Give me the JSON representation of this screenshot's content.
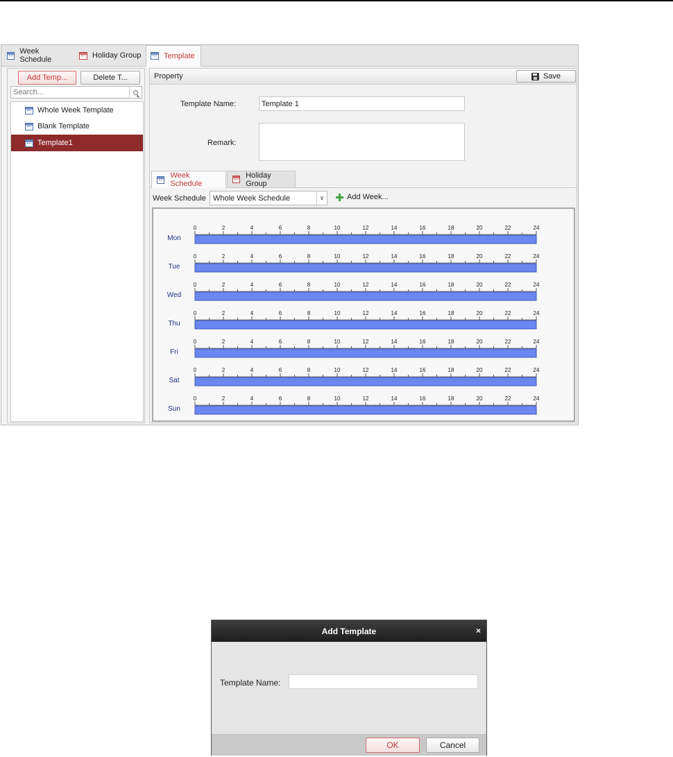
{
  "top_tabs": [
    {
      "label": "Week Schedule",
      "icon": "calendar-icon"
    },
    {
      "label": "Holiday Group",
      "icon": "holiday-calendar-icon"
    },
    {
      "label": "Template",
      "icon": "template-icon",
      "active": true
    }
  ],
  "left_panel": {
    "add_button": "Add Temp...",
    "delete_button": "Delete T...",
    "search_placeholder": "Search...",
    "templates": [
      {
        "label": "Whole Week Template",
        "selected": false
      },
      {
        "label": "Blank Template",
        "selected": false
      },
      {
        "label": "Template1",
        "selected": true
      }
    ]
  },
  "property": {
    "title": "Property",
    "save_label": "Save",
    "template_name_label": "Template Name:",
    "template_name_value": "Template 1",
    "remark_label": "Remark:",
    "remark_value": ""
  },
  "sub_tabs": [
    {
      "label": "Week Schedule",
      "active": true
    },
    {
      "label": "Holiday Group",
      "active": false
    }
  ],
  "week_schedule": {
    "label": "Week Schedule",
    "selected": "Whole Week Schedule",
    "add_week_label": "Add Week...",
    "hour_labels": [
      "0",
      "2",
      "4",
      "6",
      "8",
      "10",
      "12",
      "14",
      "16",
      "18",
      "20",
      "22",
      "24"
    ],
    "days": [
      {
        "day": "Mon",
        "start": 0,
        "end": 24
      },
      {
        "day": "Tue",
        "start": 0,
        "end": 24
      },
      {
        "day": "Wed",
        "start": 0,
        "end": 24
      },
      {
        "day": "Thu",
        "start": 0,
        "end": 24
      },
      {
        "day": "Fri",
        "start": 0,
        "end": 24
      },
      {
        "day": "Sat",
        "start": 0,
        "end": 24
      },
      {
        "day": "Sun",
        "start": 0,
        "end": 24
      }
    ],
    "bar_color": "#6b87f0",
    "day_label_color": "#1f2f8a"
  },
  "dialog": {
    "title": "Add Template",
    "close": "×",
    "template_name_label": "Template Name:",
    "template_name_value": "",
    "ok_label": "OK",
    "cancel_label": "Cancel"
  }
}
